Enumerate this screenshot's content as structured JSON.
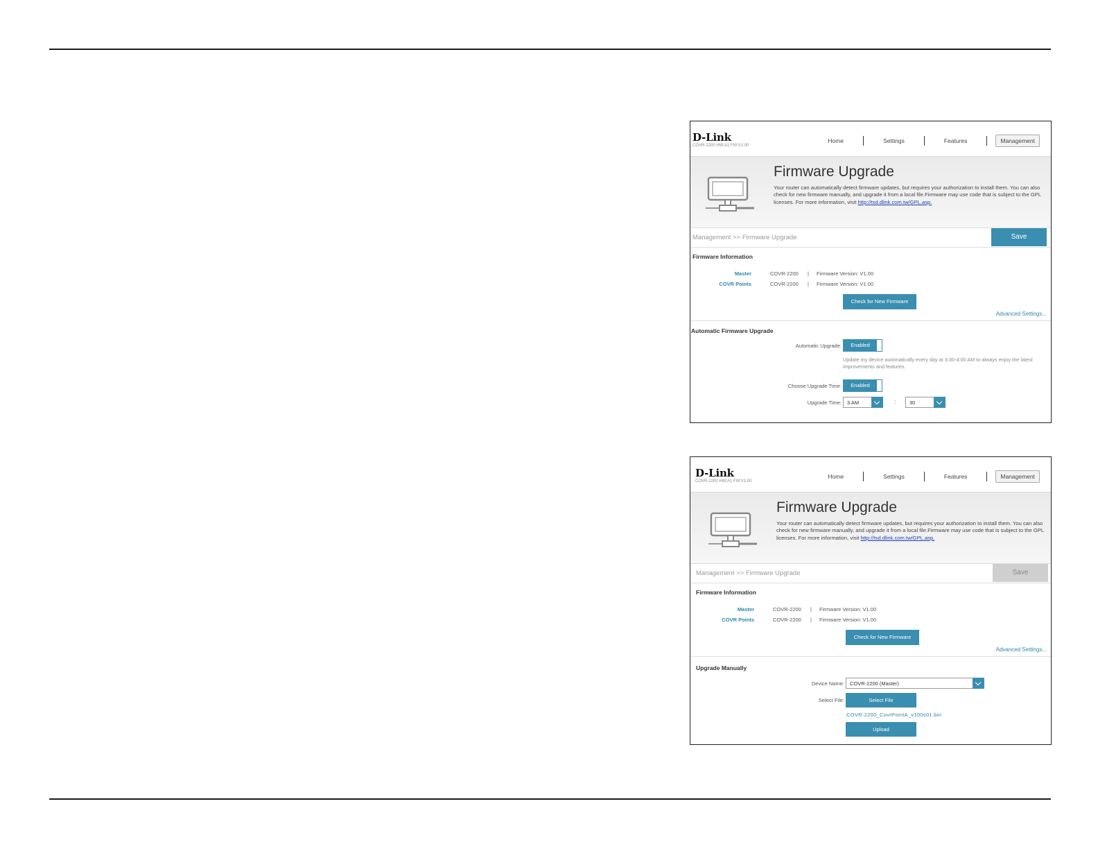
{
  "screens": [
    {
      "header": {
        "logo": "D-Link",
        "model": "COVR-2200 HW:A1 FW:V1.00",
        "nav": [
          "Home",
          "Settings",
          "Features",
          "Management"
        ]
      },
      "hero": {
        "title": "Firmware Upgrade",
        "desc": "Your router can automatically detect firmware updates, but requires your authorization to install them. You can also check for new firmware manually, and upgrade it from a local file.Firmware may use code that is subject to the GPL licenses. For more information, visit ",
        "link": "http://tsd.dlink.com.tw/GPL.asp."
      },
      "breadcrumb": "Management >> Firmware Upgrade",
      "save_label": "Save",
      "firmware_info": {
        "title": "Firmware Information",
        "rows": [
          {
            "label": "Master",
            "device": "COVR-2200",
            "sep": "|",
            "version": "Firmware Version: V1.00"
          },
          {
            "label": "COVR Points",
            "device": "COVR-2200",
            "sep": "|",
            "version": "Firmware Version: V1.00"
          }
        ],
        "check_label": "Check for New Firmware",
        "advanced_label": "Advanced Settings..."
      },
      "auto": {
        "title": "Automatic Firmware Upgrade",
        "auto_label": "Automatic Upgrade:",
        "auto_value": "Enabled",
        "note": "Update my device automatically every day at 3:30-4:00 AM to always enjoy the latest improvements and features.",
        "time_label": "Choose Upgrade Time:",
        "time_value": "Enabled",
        "upgrade_time_label": "Upgrade Time:",
        "hour": "3 AM",
        "colon": ":",
        "minute": "30"
      }
    },
    {
      "header": {
        "logo": "D-Link",
        "model": "COVR-2200 HW:A1 FW:V1.00",
        "nav": [
          "Home",
          "Settings",
          "Features",
          "Management"
        ]
      },
      "hero": {
        "title": "Firmware Upgrade",
        "desc": "Your router can automatically detect firmware updates, but requires your authorization to install them. You can also check for new firmware manually, and upgrade it from a local file.Firmware may use code that is subject to the GPL licenses. For more information, visit ",
        "link": "http://tsd.dlink.com.tw/GPL.asp."
      },
      "breadcrumb": "Management >> Firmware Upgrade",
      "save_label": "Save",
      "firmware_info": {
        "title": "Firmware Information",
        "rows": [
          {
            "label": "Master",
            "device": "COVR-2200",
            "sep": "|",
            "version": "Firmware Version: V1.00"
          },
          {
            "label": "COVR Points",
            "device": "COVR-2200",
            "sep": "|",
            "version": "Firmware Version: V1.00"
          }
        ],
        "check_label": "Check for New Firmware",
        "advanced_label": "Advanced Settings..."
      },
      "manual": {
        "title": "Upgrade Manually",
        "device_label": "Device Name:",
        "device_value": "COVR-2200 (Master)",
        "file_label": "Select File:",
        "select_file_label": "Select File",
        "file_name": "COVR-2200_CovrPointA_v100s01.bin",
        "upload_label": "Upload"
      }
    }
  ],
  "colors": {
    "accent": "#3a8eb0",
    "link": "#2e86ab",
    "disabled": "#cfcfcf"
  }
}
